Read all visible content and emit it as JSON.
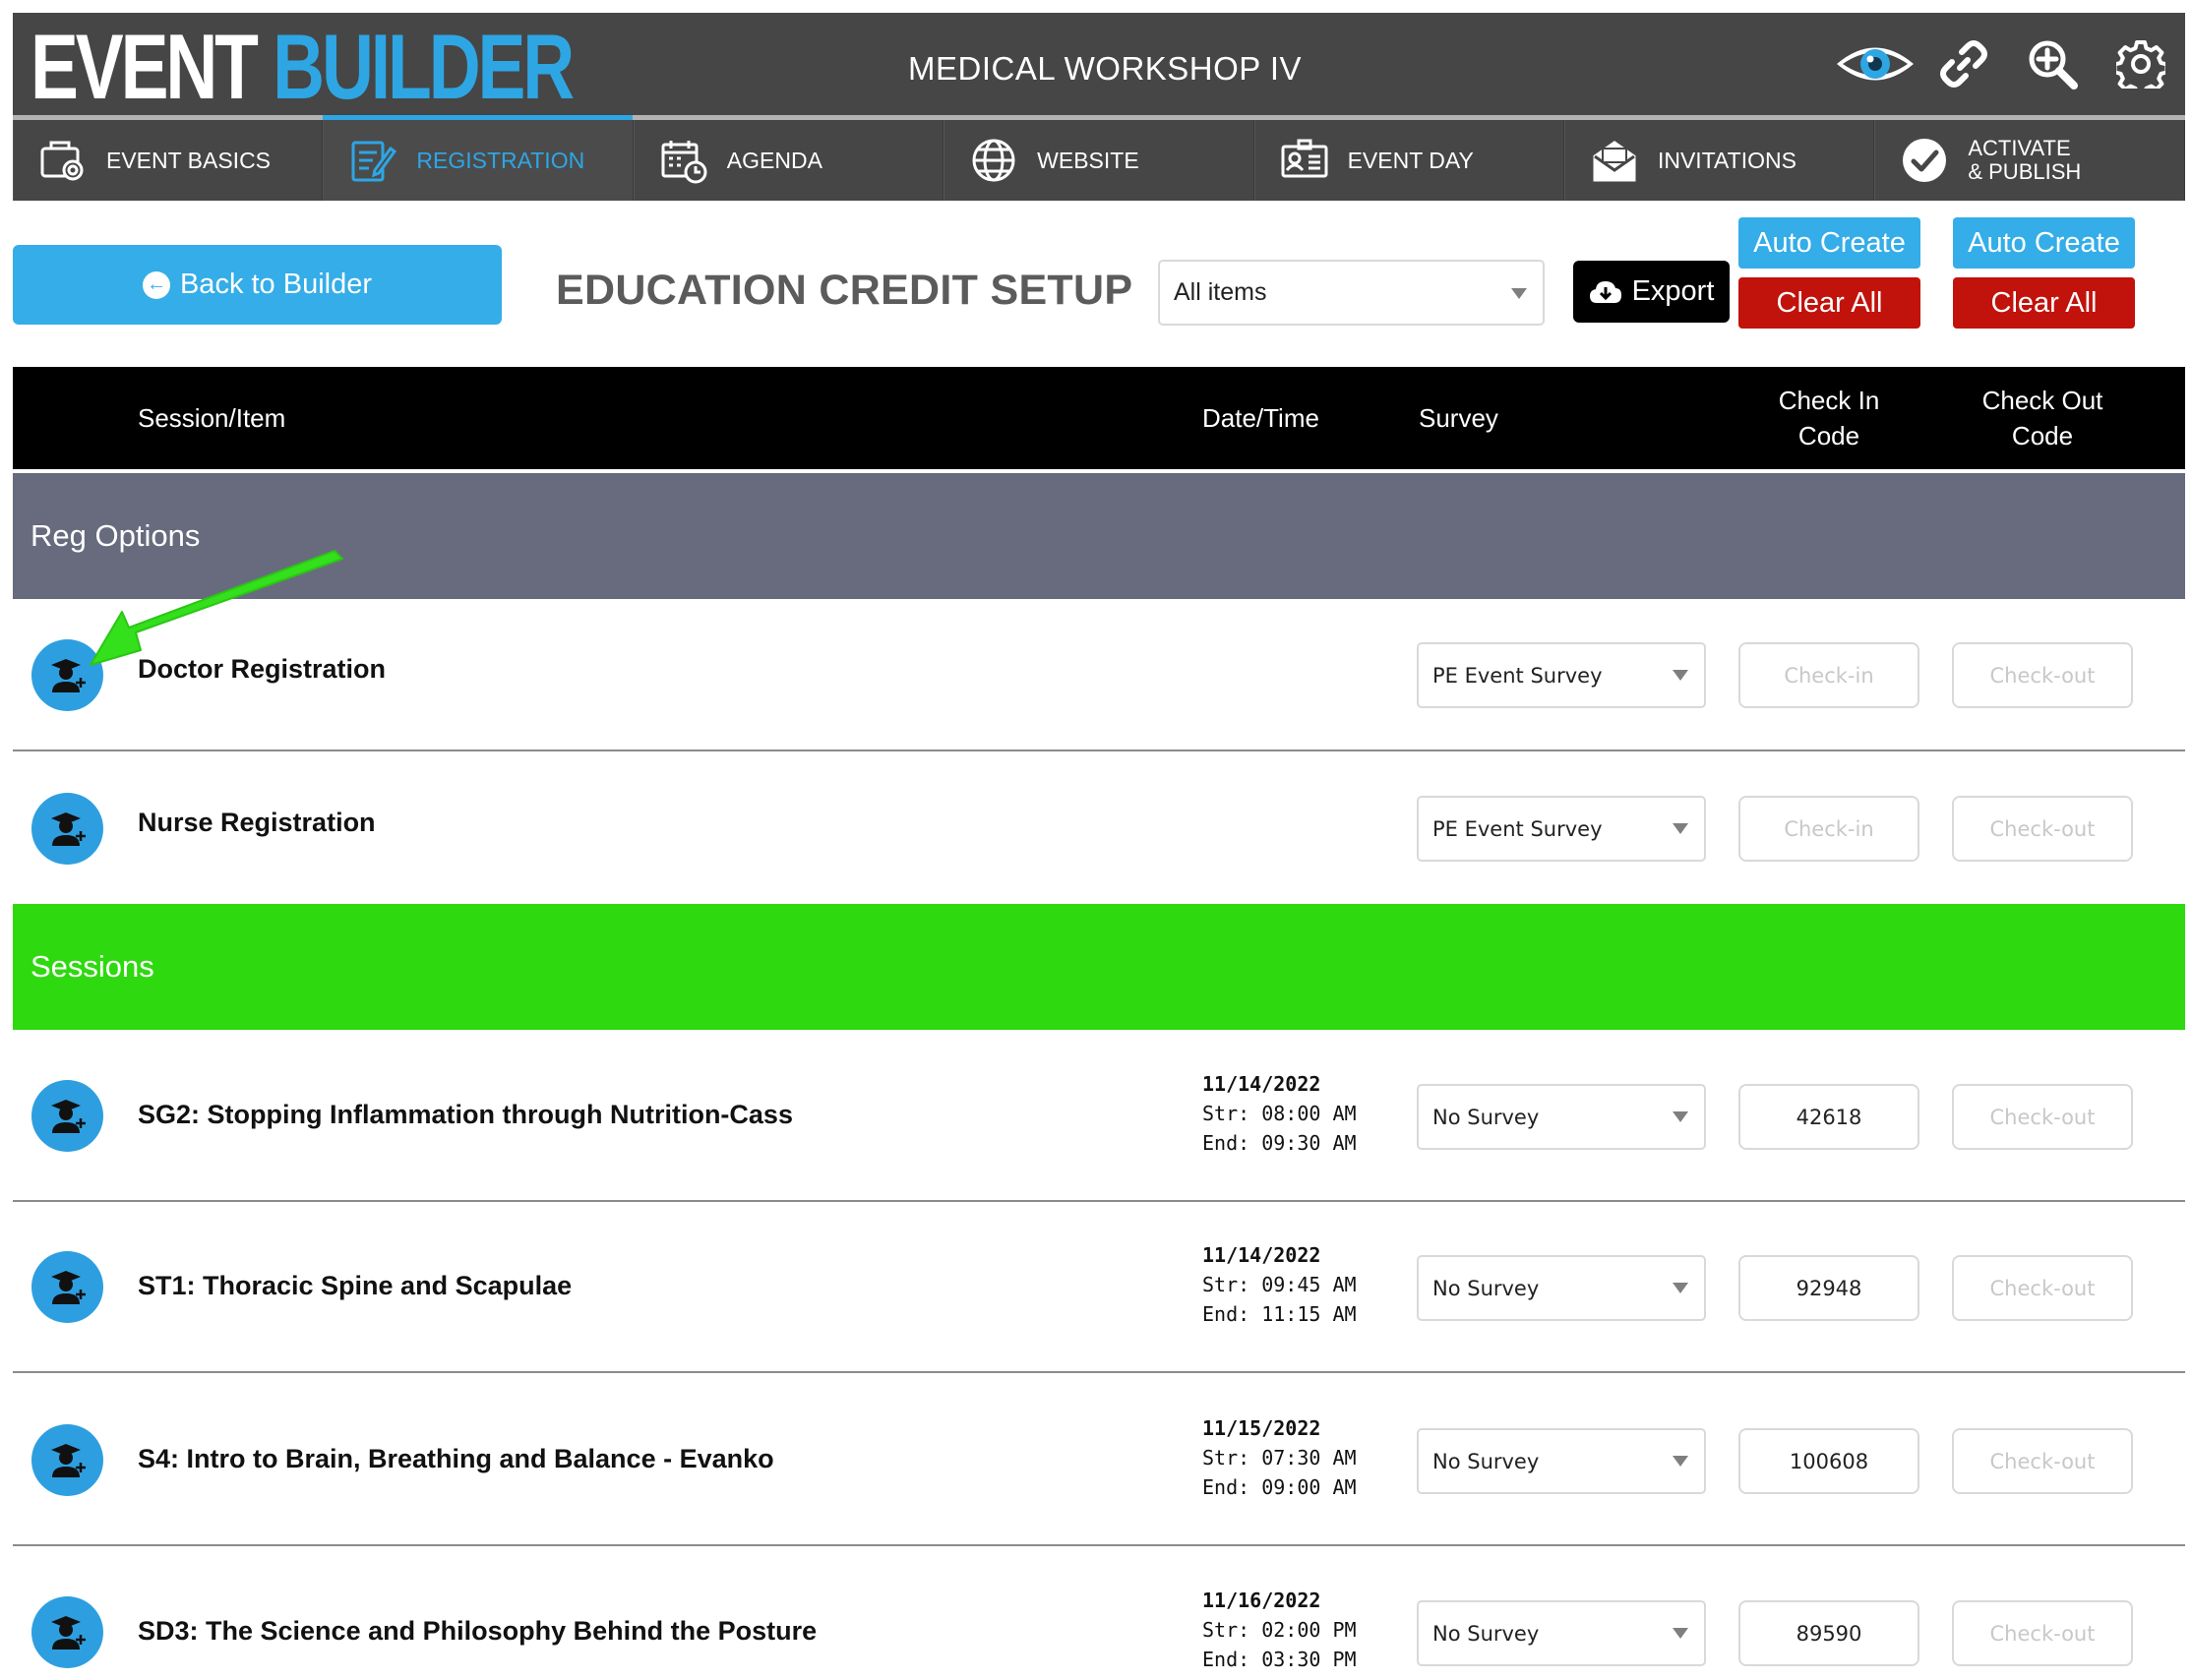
{
  "colors": {
    "brand_blue": "#2ea6e4",
    "header_bg": "#464646",
    "danger_red": "#c1120b",
    "reg_section": "#676b7d",
    "sessions_section": "#2fd90f",
    "annotation_arrow": "#33e01b"
  },
  "header": {
    "logo_part1": "EVENT",
    "logo_part2": "BUILDER",
    "event_name": "MEDICAL WORKSHOP IV",
    "icons": [
      "eye-icon",
      "link-icon",
      "zoom-in-icon",
      "gear-icon"
    ]
  },
  "nav": {
    "tabs": [
      {
        "label": "EVENT BASICS",
        "icon": "event-basics-icon",
        "active": false
      },
      {
        "label": "REGISTRATION",
        "icon": "registration-icon",
        "active": true
      },
      {
        "label": "AGENDA",
        "icon": "calendar-clock-icon",
        "active": false
      },
      {
        "label": "WEBSITE",
        "icon": "globe-icon",
        "active": false
      },
      {
        "label": "EVENT DAY",
        "icon": "badge-icon",
        "active": false
      },
      {
        "label": "INVITATIONS",
        "icon": "envelope-icon",
        "active": false
      },
      {
        "label_line1": "ACTIVATE",
        "label_line2": "& PUBLISH",
        "icon": "check-circle-icon",
        "active": false
      }
    ]
  },
  "toolbar": {
    "back_label": "Back to Builder",
    "page_title": "EDUCATION CREDIT SETUP",
    "filter_value": "All items",
    "export_label": "Export",
    "checkin": {
      "auto_create": "Auto Create",
      "clear_all": "Clear All"
    },
    "checkout": {
      "auto_create": "Auto Create",
      "clear_all": "Clear All"
    }
  },
  "table": {
    "headers": {
      "session": "Session/Item",
      "datetime": "Date/Time",
      "survey": "Survey",
      "checkin_line1": "Check In",
      "checkin_line2": "Code",
      "checkout_line1": "Check Out",
      "checkout_line2": "Code"
    },
    "sections": {
      "reg_options": "Reg Options",
      "sessions": "Sessions"
    },
    "reg_rows": [
      {
        "title": "Doctor Registration",
        "survey": "PE Event Survey",
        "checkin_placeholder": "Check-in",
        "checkout_placeholder": "Check-out"
      },
      {
        "title": "Nurse Registration",
        "survey": "PE Event Survey",
        "checkin_placeholder": "Check-in",
        "checkout_placeholder": "Check-out"
      }
    ],
    "session_rows": [
      {
        "title": "SG2: Stopping Inflammation through Nutrition-Cass",
        "date": "11/14/2022",
        "start": "Str: 08:00 AM",
        "end": "End: 09:30 AM",
        "survey": "No Survey",
        "checkin_code": "42618",
        "checkout_placeholder": "Check-out"
      },
      {
        "title": "ST1: Thoracic Spine and Scapulae",
        "date": "11/14/2022",
        "start": "Str: 09:45 AM",
        "end": "End: 11:15 AM",
        "survey": "No Survey",
        "checkin_code": "92948",
        "checkout_placeholder": "Check-out"
      },
      {
        "title": "S4: Intro to Brain, Breathing and Balance - Evanko",
        "date": "11/15/2022",
        "start": "Str: 07:30 AM",
        "end": "End: 09:00 AM",
        "survey": "No Survey",
        "checkin_code": "100608",
        "checkout_placeholder": "Check-out"
      },
      {
        "title": "SD3: The Science and Philosophy Behind the Posture",
        "date": "11/16/2022",
        "start": "Str: 02:00 PM",
        "end": "End: 03:30 PM",
        "survey": "No Survey",
        "checkin_code": "89590",
        "checkout_placeholder": "Check-out"
      }
    ]
  }
}
